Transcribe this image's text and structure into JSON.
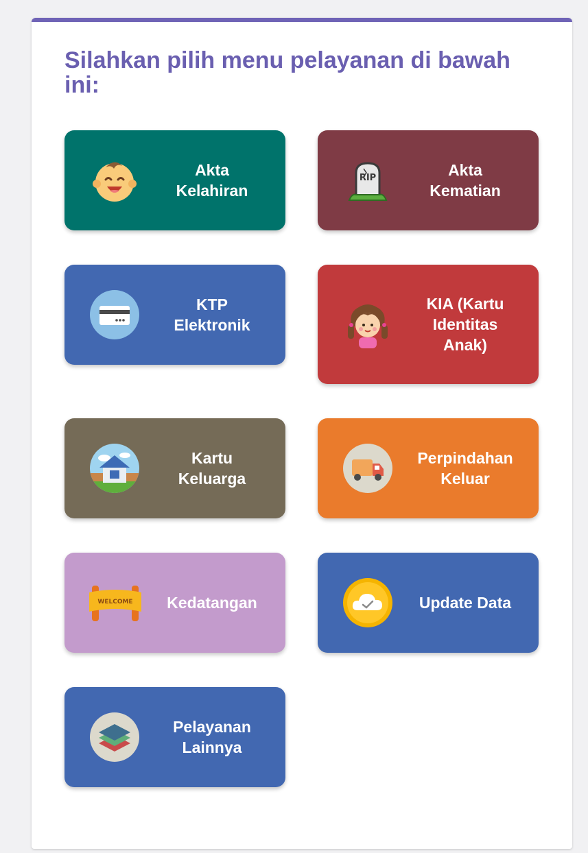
{
  "heading": "Silahkan pilih menu pelayanan di bawah ini:",
  "menu": [
    {
      "lines": [
        "Akta",
        "Kelahiran"
      ],
      "color": "#00736b",
      "icon": "baby-face-icon"
    },
    {
      "lines": [
        "Akta",
        "Kematian"
      ],
      "color": "#7f3b45",
      "icon": "rip-tombstone-icon"
    },
    {
      "lines": [
        "KTP",
        "Elektronik"
      ],
      "color": "#4268b1",
      "icon": "credit-card-icon"
    },
    {
      "lines": [
        "KIA (Kartu",
        "Identitas",
        "Anak)"
      ],
      "color": "#c13a3c",
      "icon": "girl-child-icon"
    },
    {
      "lines": [
        "Kartu",
        "Keluarga"
      ],
      "color": "#756b57",
      "icon": "house-icon"
    },
    {
      "lines": [
        "Perpindahan",
        "Keluar"
      ],
      "color": "#ea7b2c",
      "icon": "moving-truck-icon"
    },
    {
      "lines": [
        "Kedatangan"
      ],
      "color": "#c39bcc",
      "icon": "welcome-banner-icon"
    },
    {
      "lines": [
        "Update Data"
      ],
      "color": "#4268b1",
      "icon": "cloud-check-icon"
    },
    {
      "lines": [
        "Pelayanan",
        "Lainnya"
      ],
      "color": "#4268b1",
      "icon": "layers-icon"
    }
  ],
  "icon_texts": {
    "tombstone": "RIP",
    "banner": "WELCOME"
  }
}
